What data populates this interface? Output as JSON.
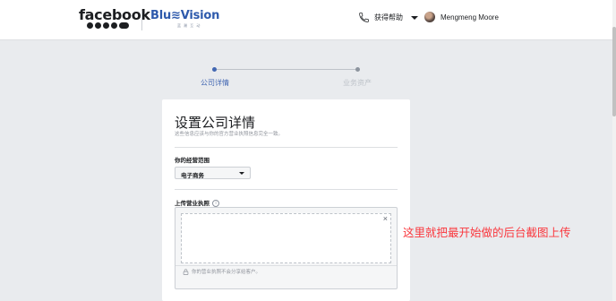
{
  "header": {
    "brand": "facebook",
    "partner_brand": "Blu≋Vision",
    "partner_subtitle": "蓝 瀚 互 动",
    "help_label": "获得帮助",
    "user_name": "Mengmeng Moore"
  },
  "steps": [
    {
      "label": "公司详情",
      "state": "active"
    },
    {
      "label": "业务资产",
      "state": "inactive"
    }
  ],
  "form": {
    "title": "设置公司详情",
    "subtitle": "这些信息应该与你的官方营业执照信息完全一致。",
    "scope_label": "你的经营范围",
    "scope_value": "电子商务",
    "license_label": "上传营业执照",
    "license_info_icon": "i",
    "close_glyph": "×",
    "privacy_note": "你的营业执照不会分享给客户。"
  },
  "annotation": "这里就把最开始做的后台截图上传",
  "colors": {
    "accent": "#4267b2",
    "annotation": "#fa383e",
    "background": "#e9ebee"
  },
  "icons": [
    "phone-icon",
    "caret-down-icon",
    "info-icon",
    "close-icon",
    "lock-icon"
  ]
}
